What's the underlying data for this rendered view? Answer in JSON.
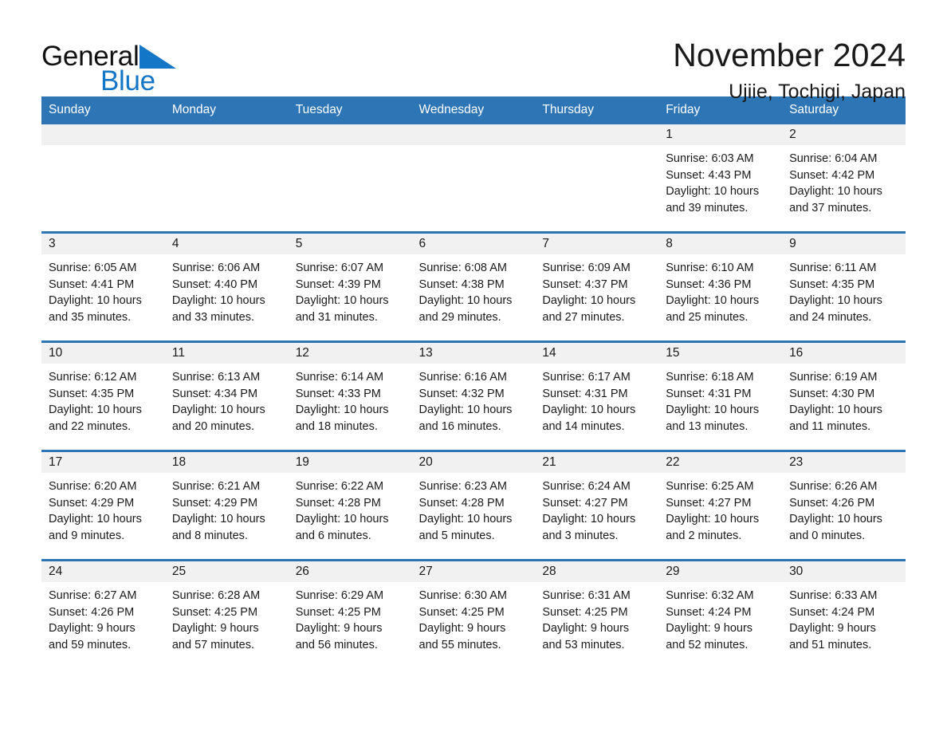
{
  "brand": {
    "name_dark": "General",
    "name_light": "Blue",
    "triangle_icon": "blue-triangle-icon",
    "dark_color": "#111111",
    "accent_color": "#1476c6"
  },
  "header": {
    "title": "November 2024",
    "subtitle": "Ujiie, Tochigi, Japan"
  },
  "theme": {
    "header_blue": "#2E75B6",
    "band_gray": "#F1F1F1",
    "text": "#1A1A1A",
    "page_background": "#FFFFFF"
  },
  "weekday_headers": [
    "Sunday",
    "Monday",
    "Tuesday",
    "Wednesday",
    "Thursday",
    "Friday",
    "Saturday"
  ],
  "weeks": [
    [
      {
        "day": "",
        "sunrise": "",
        "sunset": "",
        "daylight_line1": "",
        "daylight_line2": ""
      },
      {
        "day": "",
        "sunrise": "",
        "sunset": "",
        "daylight_line1": "",
        "daylight_line2": ""
      },
      {
        "day": "",
        "sunrise": "",
        "sunset": "",
        "daylight_line1": "",
        "daylight_line2": ""
      },
      {
        "day": "",
        "sunrise": "",
        "sunset": "",
        "daylight_line1": "",
        "daylight_line2": ""
      },
      {
        "day": "",
        "sunrise": "",
        "sunset": "",
        "daylight_line1": "",
        "daylight_line2": ""
      },
      {
        "day": "1",
        "sunrise": "Sunrise: 6:03 AM",
        "sunset": "Sunset: 4:43 PM",
        "daylight_line1": "Daylight: 10 hours",
        "daylight_line2": "and 39 minutes."
      },
      {
        "day": "2",
        "sunrise": "Sunrise: 6:04 AM",
        "sunset": "Sunset: 4:42 PM",
        "daylight_line1": "Daylight: 10 hours",
        "daylight_line2": "and 37 minutes."
      }
    ],
    [
      {
        "day": "3",
        "sunrise": "Sunrise: 6:05 AM",
        "sunset": "Sunset: 4:41 PM",
        "daylight_line1": "Daylight: 10 hours",
        "daylight_line2": "and 35 minutes."
      },
      {
        "day": "4",
        "sunrise": "Sunrise: 6:06 AM",
        "sunset": "Sunset: 4:40 PM",
        "daylight_line1": "Daylight: 10 hours",
        "daylight_line2": "and 33 minutes."
      },
      {
        "day": "5",
        "sunrise": "Sunrise: 6:07 AM",
        "sunset": "Sunset: 4:39 PM",
        "daylight_line1": "Daylight: 10 hours",
        "daylight_line2": "and 31 minutes."
      },
      {
        "day": "6",
        "sunrise": "Sunrise: 6:08 AM",
        "sunset": "Sunset: 4:38 PM",
        "daylight_line1": "Daylight: 10 hours",
        "daylight_line2": "and 29 minutes."
      },
      {
        "day": "7",
        "sunrise": "Sunrise: 6:09 AM",
        "sunset": "Sunset: 4:37 PM",
        "daylight_line1": "Daylight: 10 hours",
        "daylight_line2": "and 27 minutes."
      },
      {
        "day": "8",
        "sunrise": "Sunrise: 6:10 AM",
        "sunset": "Sunset: 4:36 PM",
        "daylight_line1": "Daylight: 10 hours",
        "daylight_line2": "and 25 minutes."
      },
      {
        "day": "9",
        "sunrise": "Sunrise: 6:11 AM",
        "sunset": "Sunset: 4:35 PM",
        "daylight_line1": "Daylight: 10 hours",
        "daylight_line2": "and 24 minutes."
      }
    ],
    [
      {
        "day": "10",
        "sunrise": "Sunrise: 6:12 AM",
        "sunset": "Sunset: 4:35 PM",
        "daylight_line1": "Daylight: 10 hours",
        "daylight_line2": "and 22 minutes."
      },
      {
        "day": "11",
        "sunrise": "Sunrise: 6:13 AM",
        "sunset": "Sunset: 4:34 PM",
        "daylight_line1": "Daylight: 10 hours",
        "daylight_line2": "and 20 minutes."
      },
      {
        "day": "12",
        "sunrise": "Sunrise: 6:14 AM",
        "sunset": "Sunset: 4:33 PM",
        "daylight_line1": "Daylight: 10 hours",
        "daylight_line2": "and 18 minutes."
      },
      {
        "day": "13",
        "sunrise": "Sunrise: 6:16 AM",
        "sunset": "Sunset: 4:32 PM",
        "daylight_line1": "Daylight: 10 hours",
        "daylight_line2": "and 16 minutes."
      },
      {
        "day": "14",
        "sunrise": "Sunrise: 6:17 AM",
        "sunset": "Sunset: 4:31 PM",
        "daylight_line1": "Daylight: 10 hours",
        "daylight_line2": "and 14 minutes."
      },
      {
        "day": "15",
        "sunrise": "Sunrise: 6:18 AM",
        "sunset": "Sunset: 4:31 PM",
        "daylight_line1": "Daylight: 10 hours",
        "daylight_line2": "and 13 minutes."
      },
      {
        "day": "16",
        "sunrise": "Sunrise: 6:19 AM",
        "sunset": "Sunset: 4:30 PM",
        "daylight_line1": "Daylight: 10 hours",
        "daylight_line2": "and 11 minutes."
      }
    ],
    [
      {
        "day": "17",
        "sunrise": "Sunrise: 6:20 AM",
        "sunset": "Sunset: 4:29 PM",
        "daylight_line1": "Daylight: 10 hours",
        "daylight_line2": "and 9 minutes."
      },
      {
        "day": "18",
        "sunrise": "Sunrise: 6:21 AM",
        "sunset": "Sunset: 4:29 PM",
        "daylight_line1": "Daylight: 10 hours",
        "daylight_line2": "and 8 minutes."
      },
      {
        "day": "19",
        "sunrise": "Sunrise: 6:22 AM",
        "sunset": "Sunset: 4:28 PM",
        "daylight_line1": "Daylight: 10 hours",
        "daylight_line2": "and 6 minutes."
      },
      {
        "day": "20",
        "sunrise": "Sunrise: 6:23 AM",
        "sunset": "Sunset: 4:28 PM",
        "daylight_line1": "Daylight: 10 hours",
        "daylight_line2": "and 5 minutes."
      },
      {
        "day": "21",
        "sunrise": "Sunrise: 6:24 AM",
        "sunset": "Sunset: 4:27 PM",
        "daylight_line1": "Daylight: 10 hours",
        "daylight_line2": "and 3 minutes."
      },
      {
        "day": "22",
        "sunrise": "Sunrise: 6:25 AM",
        "sunset": "Sunset: 4:27 PM",
        "daylight_line1": "Daylight: 10 hours",
        "daylight_line2": "and 2 minutes."
      },
      {
        "day": "23",
        "sunrise": "Sunrise: 6:26 AM",
        "sunset": "Sunset: 4:26 PM",
        "daylight_line1": "Daylight: 10 hours",
        "daylight_line2": "and 0 minutes."
      }
    ],
    [
      {
        "day": "24",
        "sunrise": "Sunrise: 6:27 AM",
        "sunset": "Sunset: 4:26 PM",
        "daylight_line1": "Daylight: 9 hours",
        "daylight_line2": "and 59 minutes."
      },
      {
        "day": "25",
        "sunrise": "Sunrise: 6:28 AM",
        "sunset": "Sunset: 4:25 PM",
        "daylight_line1": "Daylight: 9 hours",
        "daylight_line2": "and 57 minutes."
      },
      {
        "day": "26",
        "sunrise": "Sunrise: 6:29 AM",
        "sunset": "Sunset: 4:25 PM",
        "daylight_line1": "Daylight: 9 hours",
        "daylight_line2": "and 56 minutes."
      },
      {
        "day": "27",
        "sunrise": "Sunrise: 6:30 AM",
        "sunset": "Sunset: 4:25 PM",
        "daylight_line1": "Daylight: 9 hours",
        "daylight_line2": "and 55 minutes."
      },
      {
        "day": "28",
        "sunrise": "Sunrise: 6:31 AM",
        "sunset": "Sunset: 4:25 PM",
        "daylight_line1": "Daylight: 9 hours",
        "daylight_line2": "and 53 minutes."
      },
      {
        "day": "29",
        "sunrise": "Sunrise: 6:32 AM",
        "sunset": "Sunset: 4:24 PM",
        "daylight_line1": "Daylight: 9 hours",
        "daylight_line2": "and 52 minutes."
      },
      {
        "day": "30",
        "sunrise": "Sunrise: 6:33 AM",
        "sunset": "Sunset: 4:24 PM",
        "daylight_line1": "Daylight: 9 hours",
        "daylight_line2": "and 51 minutes."
      }
    ]
  ]
}
